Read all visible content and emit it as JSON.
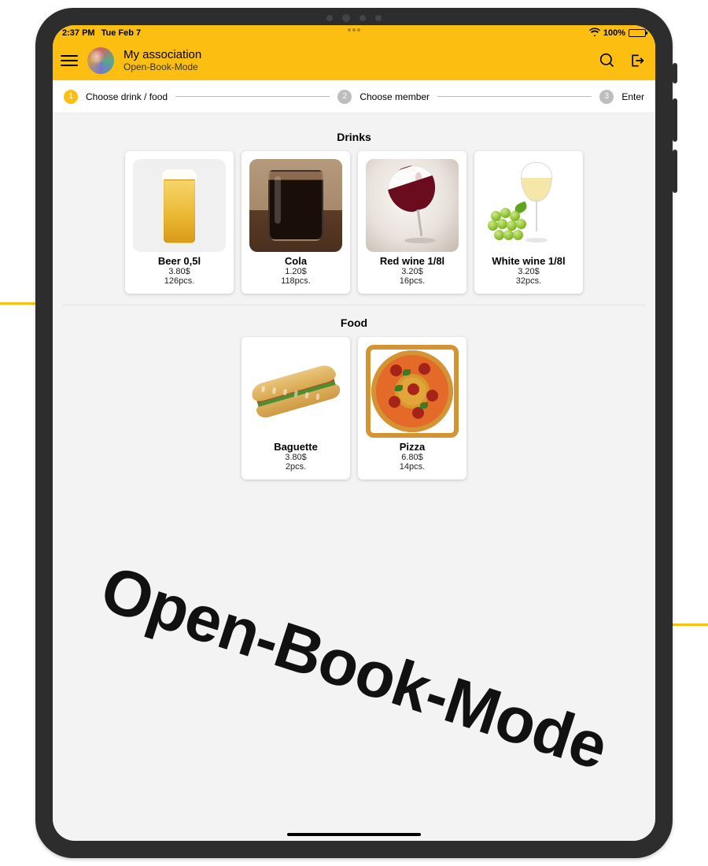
{
  "statusbar": {
    "time": "2:37 PM",
    "date": "Tue Feb 7",
    "battery": "100%"
  },
  "header": {
    "title": "My association",
    "subtitle": "Open-Book-Mode"
  },
  "stepper": {
    "steps": [
      {
        "num": "1",
        "label": "Choose drink / food"
      },
      {
        "num": "2",
        "label": "Choose member"
      },
      {
        "num": "3",
        "label": "Enter"
      }
    ]
  },
  "sections": {
    "drinks": {
      "title": "Drinks",
      "items": [
        {
          "name": "Beer 0,5l",
          "price": "3.80$",
          "stock": "126pcs."
        },
        {
          "name": "Cola",
          "price": "1.20$",
          "stock": "118pcs."
        },
        {
          "name": "Red wine 1/8l",
          "price": "3.20$",
          "stock": "16pcs."
        },
        {
          "name": "White wine 1/8l",
          "price": "3.20$",
          "stock": "32pcs."
        }
      ]
    },
    "food": {
      "title": "Food",
      "items": [
        {
          "name": "Baguette",
          "price": "3.80$",
          "stock": "2pcs."
        },
        {
          "name": "Pizza",
          "price": "6.80$",
          "stock": "14pcs."
        }
      ]
    }
  },
  "watermark": "Open-Book-Mode"
}
